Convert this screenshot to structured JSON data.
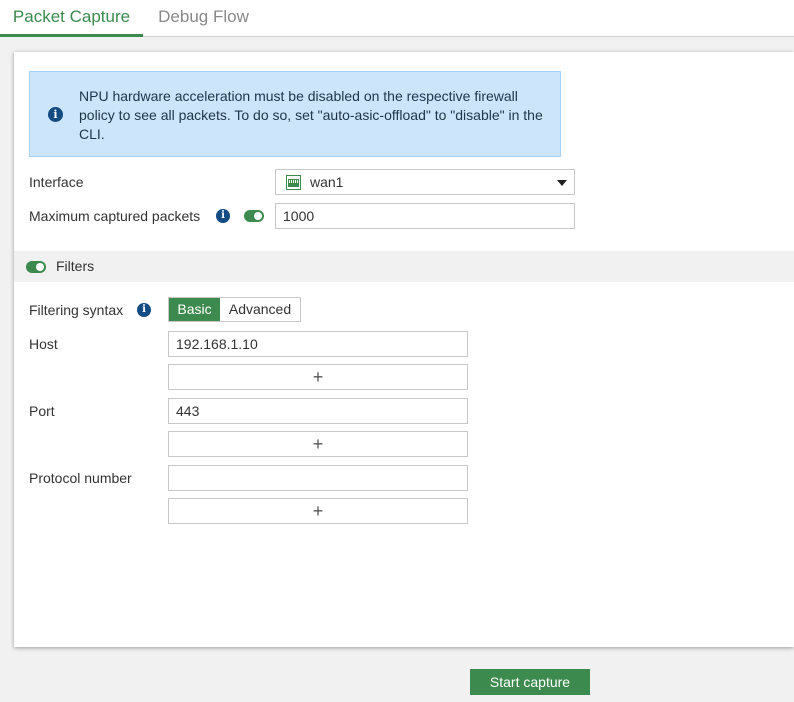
{
  "tabs": [
    {
      "label": "Packet Capture",
      "active": true
    },
    {
      "label": "Debug Flow",
      "active": false
    }
  ],
  "notice": {
    "icon": "info-icon",
    "text": "NPU hardware acceleration must be disabled on the respective firewall policy to see all packets. To do so, set \"auto-asic-offload\" to \"disable\" in the CLI."
  },
  "form": {
    "interface_label": "Interface",
    "interface_value": "wan1",
    "interface_icon": "network-port-icon",
    "max_packets_label": "Maximum captured packets",
    "max_packets_enabled": true,
    "max_packets_value": "1000"
  },
  "filters": {
    "label": "Filters",
    "enabled": true,
    "syntax_label": "Filtering syntax",
    "syntax_options": [
      "Basic",
      "Advanced"
    ],
    "syntax_selected": "Basic",
    "host_label": "Host",
    "host_value": "192.168.1.10",
    "port_label": "Port",
    "port_value": "443",
    "protocol_label": "Protocol number",
    "protocol_value": "",
    "add_symbol": "+"
  },
  "actions": {
    "start_label": "Start capture"
  },
  "colors": {
    "accent": "#3d8a4e",
    "notice_bg": "#cde5fb",
    "info_icon": "#134b83"
  }
}
